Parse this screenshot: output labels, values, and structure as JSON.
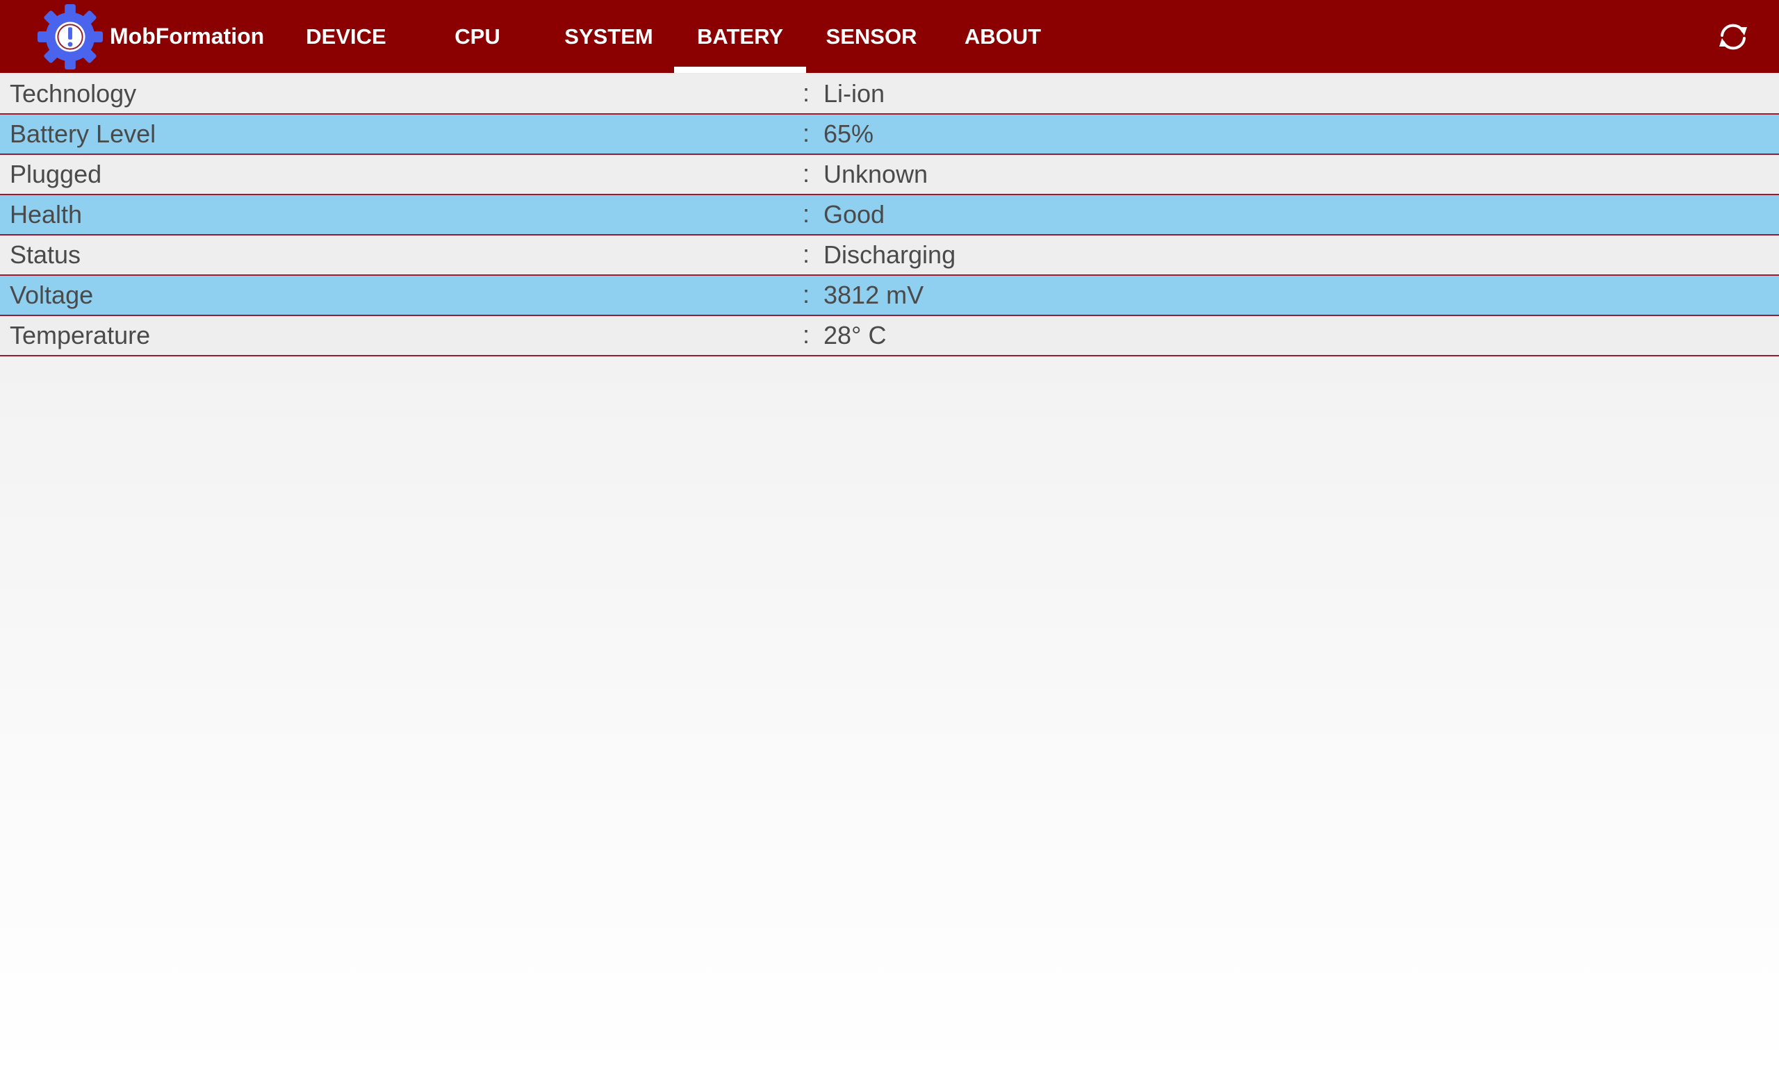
{
  "app": {
    "title": "MobFormation",
    "logo_icon": "gear-info-icon",
    "colors": {
      "appbar": "#8b0000",
      "logo": "#4a64ee",
      "row_highlight": "#8fd0f0",
      "row_plain": "#eeeeee"
    }
  },
  "tabs": [
    {
      "label": "DEVICE",
      "active": false
    },
    {
      "label": "CPU",
      "active": false
    },
    {
      "label": "SYSTEM",
      "active": false
    },
    {
      "label": "BATERY",
      "active": true
    },
    {
      "label": "SENSOR",
      "active": false
    },
    {
      "label": "ABOUT",
      "active": false
    }
  ],
  "actions": {
    "refresh_icon": "refresh-icon"
  },
  "battery": {
    "separator": ":",
    "rows": [
      {
        "label": "Technology",
        "value": "Li-ion"
      },
      {
        "label": "Battery Level",
        "value": "65%"
      },
      {
        "label": "Plugged",
        "value": "Unknown"
      },
      {
        "label": "Health",
        "value": "Good"
      },
      {
        "label": "Status",
        "value": "Discharging"
      },
      {
        "label": "Voltage",
        "value": "3812 mV"
      },
      {
        "label": "Temperature",
        "value": "28° C"
      }
    ]
  }
}
